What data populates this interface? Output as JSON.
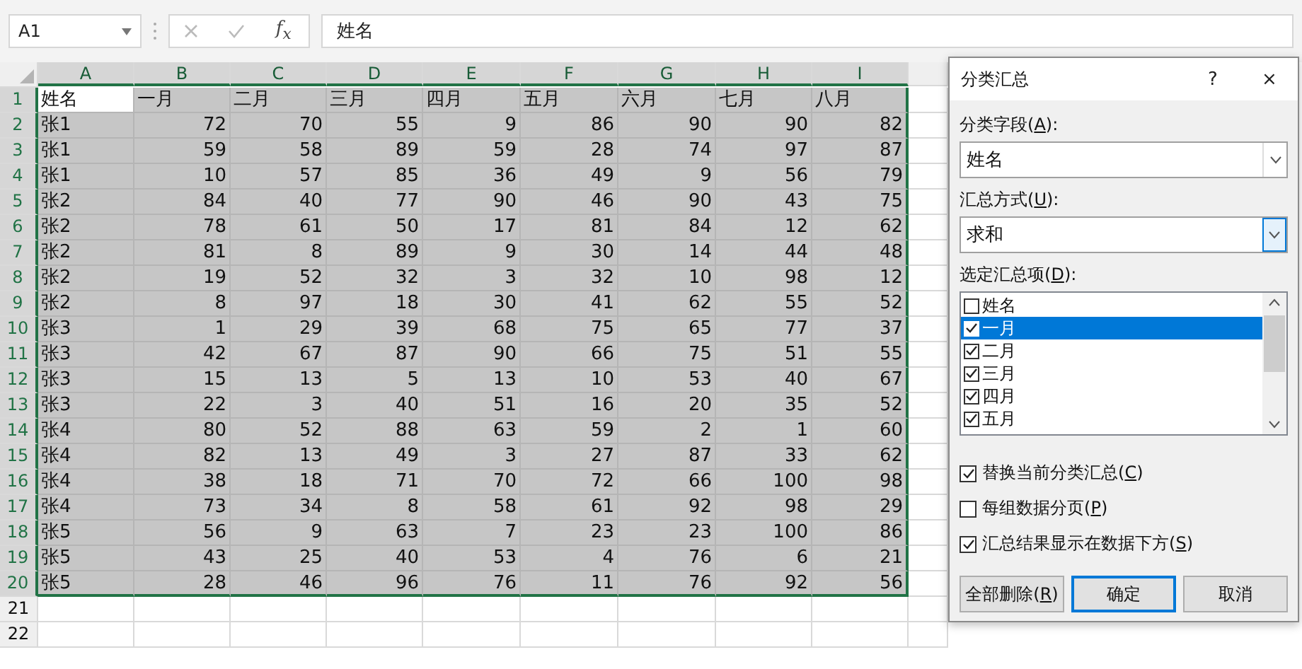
{
  "formula_bar": {
    "name_box": "A1",
    "function_button": "f$_{x}$",
    "formula": "姓名"
  },
  "sheet": {
    "columns": [
      {
        "label": "A",
        "selected": true
      },
      {
        "label": "B",
        "selected": true
      },
      {
        "label": "C",
        "selected": true
      },
      {
        "label": "D",
        "selected": true
      },
      {
        "label": "E",
        "selected": true
      },
      {
        "label": "F",
        "selected": true
      },
      {
        "label": "G",
        "selected": true
      },
      {
        "label": "H",
        "selected": true
      },
      {
        "label": "I",
        "selected": true
      }
    ],
    "rows": [
      {
        "number": "1",
        "selected": true,
        "cells": [
          "姓名",
          "一月",
          "二月",
          "三月",
          "四月",
          "五月",
          "六月",
          "七月",
          "八月"
        ]
      },
      {
        "number": "2",
        "selected": true,
        "cells": [
          "张1",
          "72",
          "70",
          "55",
          "9",
          "86",
          "90",
          "90",
          "82"
        ]
      },
      {
        "number": "3",
        "selected": true,
        "cells": [
          "张1",
          "59",
          "58",
          "89",
          "59",
          "28",
          "74",
          "97",
          "87"
        ]
      },
      {
        "number": "4",
        "selected": true,
        "cells": [
          "张1",
          "10",
          "57",
          "85",
          "36",
          "49",
          "9",
          "56",
          "79"
        ]
      },
      {
        "number": "5",
        "selected": true,
        "cells": [
          "张2",
          "84",
          "40",
          "77",
          "90",
          "46",
          "90",
          "43",
          "75"
        ]
      },
      {
        "number": "6",
        "selected": true,
        "cells": [
          "张2",
          "78",
          "61",
          "50",
          "17",
          "81",
          "84",
          "12",
          "62"
        ]
      },
      {
        "number": "7",
        "selected": true,
        "cells": [
          "张2",
          "81",
          "8",
          "89",
          "9",
          "30",
          "14",
          "44",
          "48"
        ]
      },
      {
        "number": "8",
        "selected": true,
        "cells": [
          "张2",
          "19",
          "52",
          "32",
          "3",
          "32",
          "10",
          "98",
          "12"
        ]
      },
      {
        "number": "9",
        "selected": true,
        "cells": [
          "张2",
          "8",
          "97",
          "18",
          "30",
          "41",
          "62",
          "55",
          "52"
        ]
      },
      {
        "number": "10",
        "selected": true,
        "cells": [
          "张3",
          "1",
          "29",
          "39",
          "68",
          "75",
          "65",
          "77",
          "37"
        ]
      },
      {
        "number": "11",
        "selected": true,
        "cells": [
          "张3",
          "42",
          "67",
          "87",
          "90",
          "66",
          "75",
          "51",
          "55"
        ]
      },
      {
        "number": "12",
        "selected": true,
        "cells": [
          "张3",
          "15",
          "13",
          "5",
          "13",
          "10",
          "53",
          "40",
          "67"
        ]
      },
      {
        "number": "13",
        "selected": true,
        "cells": [
          "张3",
          "22",
          "3",
          "40",
          "51",
          "16",
          "20",
          "35",
          "52"
        ]
      },
      {
        "number": "14",
        "selected": true,
        "cells": [
          "张4",
          "80",
          "52",
          "88",
          "63",
          "59",
          "2",
          "1",
          "60"
        ]
      },
      {
        "number": "15",
        "selected": true,
        "cells": [
          "张4",
          "82",
          "13",
          "49",
          "3",
          "27",
          "87",
          "33",
          "62"
        ]
      },
      {
        "number": "16",
        "selected": true,
        "cells": [
          "张4",
          "38",
          "18",
          "71",
          "70",
          "72",
          "66",
          "100",
          "98"
        ]
      },
      {
        "number": "17",
        "selected": true,
        "cells": [
          "张4",
          "73",
          "34",
          "8",
          "58",
          "61",
          "92",
          "98",
          "29"
        ]
      },
      {
        "number": "18",
        "selected": true,
        "cells": [
          "张5",
          "56",
          "9",
          "63",
          "7",
          "23",
          "23",
          "100",
          "86"
        ]
      },
      {
        "number": "19",
        "selected": true,
        "cells": [
          "张5",
          "43",
          "25",
          "40",
          "53",
          "4",
          "76",
          "6",
          "21"
        ]
      },
      {
        "number": "20",
        "selected": true,
        "cells": [
          "张5",
          "28",
          "46",
          "96",
          "76",
          "11",
          "76",
          "92",
          "56"
        ]
      },
      {
        "number": "21",
        "selected": false
      },
      {
        "number": "22",
        "selected": false
      }
    ]
  },
  "dialog": {
    "title": "分类汇总",
    "help": "?",
    "close": "×",
    "fields": [
      {
        "label": {
          "before": "分类字段(",
          "mnemonic": "A",
          "after": "):"
        },
        "value": "姓名",
        "focused": false
      },
      {
        "label": {
          "before": "汇总方式(",
          "mnemonic": "U",
          "after": "):"
        },
        "value": "求和",
        "focused": true
      }
    ],
    "list_label": {
      "before": "选定汇总项(",
      "mnemonic": "D",
      "after": "):"
    },
    "summary_items": [
      {
        "label": "姓名",
        "checked": false,
        "selected": false
      },
      {
        "label": "一月",
        "checked": true,
        "selected": true
      },
      {
        "label": "二月",
        "checked": true,
        "selected": false
      },
      {
        "label": "三月",
        "checked": true,
        "selected": false
      },
      {
        "label": "四月",
        "checked": true,
        "selected": false
      },
      {
        "label": "五月",
        "checked": true,
        "selected": false
      }
    ],
    "options": [
      {
        "label": {
          "before": "替换当前分类汇总(",
          "mnemonic": "C",
          "after": ")"
        },
        "checked": true
      },
      {
        "label": {
          "before": "每组数据分页(",
          "mnemonic": "P",
          "after": ")"
        },
        "checked": false
      },
      {
        "label": {
          "before": "汇总结果显示在数据下方(",
          "mnemonic": "S",
          "after": ")"
        },
        "checked": true
      }
    ],
    "buttons": [
      {
        "label": {
          "before": "全部删除(",
          "mnemonic": "R",
          "after": ")"
        },
        "default": false
      },
      {
        "label": {
          "before": "确定"
        },
        "default": true
      },
      {
        "label": {
          "before": "取消"
        },
        "default": false
      }
    ]
  }
}
